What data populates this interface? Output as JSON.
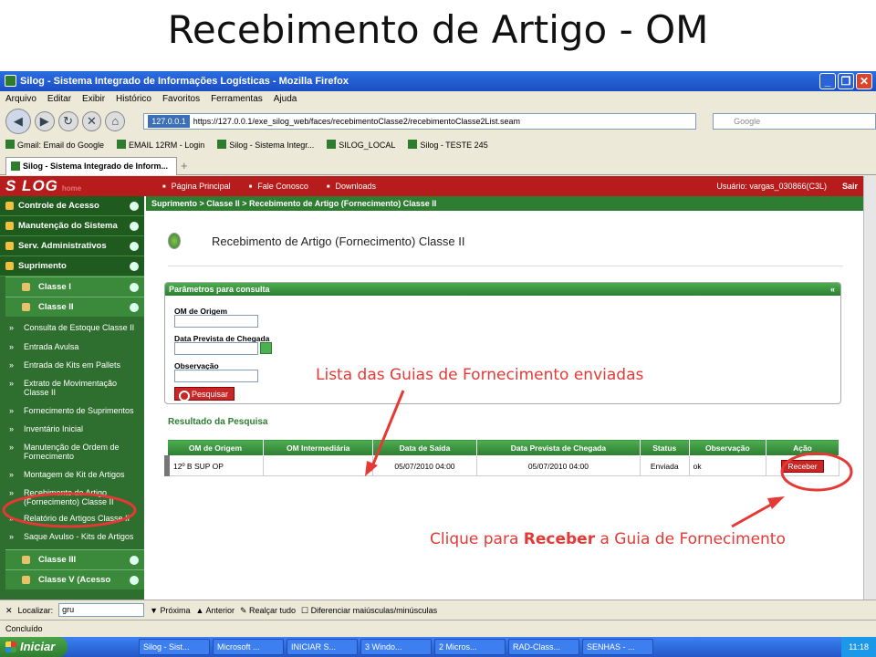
{
  "slide_title": "Recebimento de Artigo - OM",
  "window": {
    "title": "Silog - Sistema Integrado de Informações Logísticas - Mozilla Firefox"
  },
  "menu": [
    "Arquivo",
    "Editar",
    "Exibir",
    "Histórico",
    "Favoritos",
    "Ferramentas",
    "Ajuda"
  ],
  "url": {
    "chip": "127.0.0.1",
    "value": "https://127.0.0.1/exe_silog_web/faces/recebimentoClasse2/recebimentoClasse2List.seam"
  },
  "search": {
    "placeholder": "Google"
  },
  "bookmarks": [
    "Gmail: Email do Google",
    "EMAIL 12RM - Login",
    "Silog - Sistema Integr...",
    "SILOG_LOCAL",
    "Silog - TESTE 245"
  ],
  "tab": {
    "label": "Silog - Sistema Integrado de Inform..."
  },
  "app": {
    "logo": "S LOG",
    "logo_sub": "home",
    "toplinks": [
      "Página Principal",
      "Fale Conosco",
      "Downloads"
    ],
    "user": "Usuário: vargas_030866(C3L)",
    "sair": "Sair",
    "breadcrumb": "Suprimento > Classe II > Recebimento de Artigo (Fornecimento) Classe II"
  },
  "sidebar": {
    "heads": [
      "Controle de Acesso",
      "Manutenção do Sistema",
      "Serv. Administrativos",
      "Suprimento"
    ],
    "classe1": "Classe I",
    "classe2": "Classe II",
    "items": [
      "Consulta de Estoque Classe II",
      "Entrada Avulsa",
      "Entrada de Kits em Pallets",
      "Extrato de Movimentação Classe II",
      "Fornecimento de Suprimentos",
      "Inventário Inicial",
      "Manutenção de Ordem de Fornecimento",
      "Montagem de Kit de Artigos",
      "Recebimento de Artigo (Fornecimento) Classe II",
      "Relatório de Artigos Classe II",
      "Saque Avulso - Kits de Artigos"
    ],
    "classe3": "Classe III",
    "classe5": "Classe V (Acesso"
  },
  "page": {
    "title": "Recebimento de Artigo (Fornecimento) Classe II",
    "panel_title": "Parâmetros para consulta",
    "panel_collapse": "«",
    "f1": "OM de Origem",
    "f2": "Data Prevista de Chegada",
    "f3": "Observação",
    "pesquisar": "Pesquisar",
    "result_title": "Resultado da Pesquisa"
  },
  "table": {
    "headers": [
      "OM de Origem",
      "OM Intermediária",
      "Data de Saída",
      "Data Prevista de Chegada",
      "Status",
      "Observação",
      "Ação"
    ],
    "rows": [
      {
        "om": "12º B SUP OP",
        "inter": "",
        "saida": "05/07/2010 04:00",
        "prevista": "05/07/2010 04:00",
        "status": "Enviada",
        "obs": "ok",
        "acao": "Receber"
      }
    ]
  },
  "find": {
    "label": "Localizar:",
    "value": "gru",
    "next": "Próxima",
    "prev": "Anterior",
    "highlight": "Realçar tudo",
    "match": "Diferenciar maiúsculas/minúsculas"
  },
  "status": "Concluído",
  "taskbar": {
    "start": "Iniciar",
    "items": [
      "Silog - Sist...",
      "Microsoft ...",
      "INICIAR S...",
      "3 Windo...",
      "2 Micros...",
      "RAD-Class...",
      "SENHAS - ..."
    ],
    "time": "11:18"
  },
  "annotations": {
    "a1": "Lista das Guias de Fornecimento enviadas",
    "a2_pre": "Clique para ",
    "a2_bold": "Receber",
    "a2_post": " a Guia de Fornecimento",
    "color": "#e53935"
  }
}
